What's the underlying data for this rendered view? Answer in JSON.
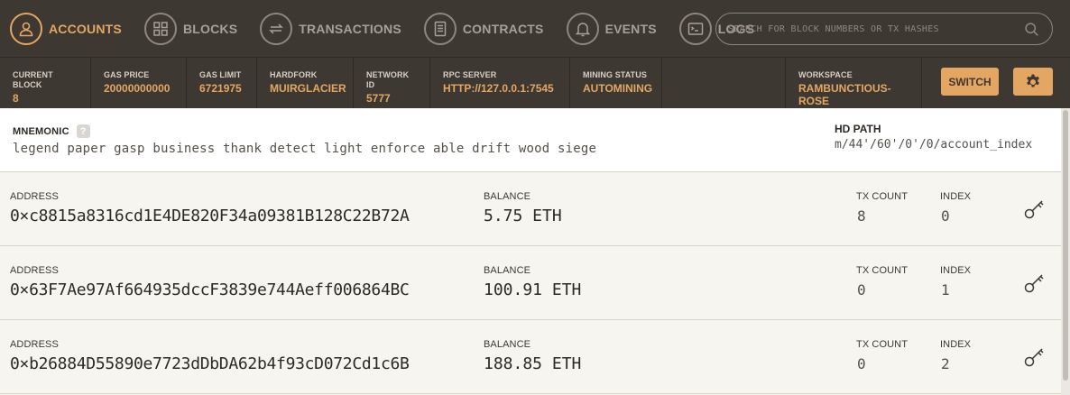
{
  "nav": {
    "items": [
      {
        "label": "ACCOUNTS",
        "icon": "person-icon",
        "active": true
      },
      {
        "label": "BLOCKS",
        "icon": "grid-icon",
        "active": false
      },
      {
        "label": "TRANSACTIONS",
        "icon": "arrows-exchange-icon",
        "active": false
      },
      {
        "label": "CONTRACTS",
        "icon": "document-icon",
        "active": false
      },
      {
        "label": "EVENTS",
        "icon": "bell-icon",
        "active": false
      },
      {
        "label": "LOGS",
        "icon": "terminal-icon",
        "active": false
      }
    ],
    "search_placeholder": "SEARCH FOR BLOCK NUMBERS OR TX HASHES"
  },
  "status": {
    "items": [
      {
        "label": "CURRENT BLOCK",
        "value": "8"
      },
      {
        "label": "GAS PRICE",
        "value": "20000000000"
      },
      {
        "label": "GAS LIMIT",
        "value": "6721975"
      },
      {
        "label": "HARDFORK",
        "value": "MUIRGLACIER"
      },
      {
        "label": "NETWORK ID",
        "value": "5777"
      },
      {
        "label": "RPC SERVER",
        "value": "HTTP://127.0.0.1:7545"
      },
      {
        "label": "MINING STATUS",
        "value": "AUTOMINING"
      }
    ],
    "workspace_label": "WORKSPACE",
    "workspace_value": "RAMBUNCTIOUS-ROSE",
    "switch_label": "SWITCH"
  },
  "mnemonic": {
    "label": "MNEMONIC",
    "help": "?",
    "words": "legend paper gasp business thank detect light enforce able drift wood siege",
    "hd_path_label": "HD PATH",
    "hd_path_value": "m/44'/60'/0'/0/account_index"
  },
  "account_labels": {
    "address": "ADDRESS",
    "balance": "BALANCE",
    "tx_count": "TX COUNT",
    "index": "INDEX"
  },
  "accounts": [
    {
      "address": "0×c8815a8316cd1E4DE820F34a09381B128C22B72A",
      "balance": "5.75 ETH",
      "tx_count": "8",
      "index": "0"
    },
    {
      "address": "0×63F7Ae97Af664935dccF3839e744Aeff006864BC",
      "balance": "100.91 ETH",
      "tx_count": "0",
      "index": "1"
    },
    {
      "address": "0×b26884D55890e7723dDbDA62b4f93cD072Cd1c6B",
      "balance": "188.85 ETH",
      "tx_count": "0",
      "index": "2"
    }
  ],
  "colors": {
    "header_bg": "#3e3832",
    "accent": "#e4a663",
    "page_bg": "#f7f5f0"
  }
}
